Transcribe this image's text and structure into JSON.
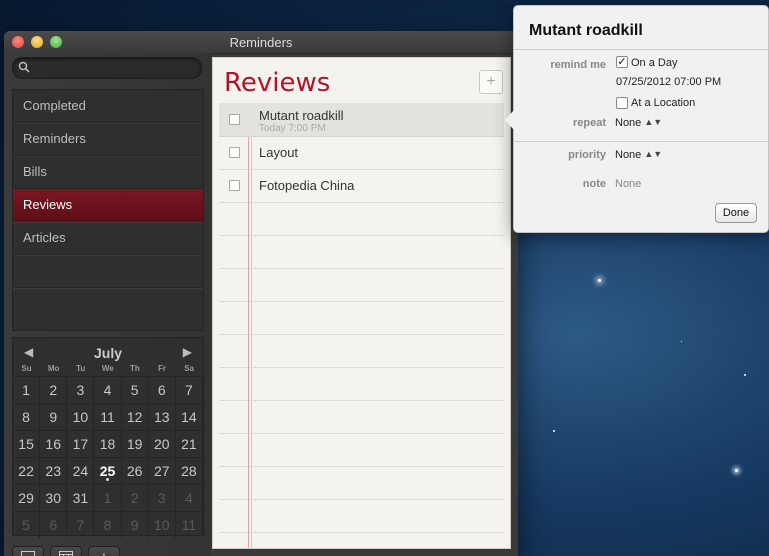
{
  "window": {
    "title": "Reminders"
  },
  "sidebar": {
    "search_placeholder": "",
    "lists": [
      {
        "label": "Completed"
      },
      {
        "label": "Reminders"
      },
      {
        "label": "Bills"
      },
      {
        "label": "Reviews",
        "selected": true
      },
      {
        "label": "Articles"
      }
    ]
  },
  "calendar": {
    "month": "July",
    "prev": "◀",
    "next": "▶",
    "weekdays": [
      "Su",
      "Mo",
      "Tu",
      "We",
      "Th",
      "Fr",
      "Sa"
    ],
    "weeks": [
      [
        "1",
        "2",
        "3",
        "4",
        "5",
        "6",
        "7"
      ],
      [
        "8",
        "9",
        "10",
        "11",
        "12",
        "13",
        "14"
      ],
      [
        "15",
        "16",
        "17",
        "18",
        "19",
        "20",
        "21"
      ],
      [
        "22",
        "23",
        "24",
        "25",
        "26",
        "27",
        "28"
      ],
      [
        "29",
        "30",
        "31",
        "1",
        "2",
        "3",
        "4"
      ],
      [
        "5",
        "6",
        "7",
        "8",
        "9",
        "10",
        "11"
      ]
    ],
    "today": "25"
  },
  "footer": {
    "add_label": "+"
  },
  "list_view": {
    "title": "Reviews",
    "add_label": "+",
    "items": [
      {
        "title": "Mutant roadkill",
        "subtitle": "Today 7:00 PM"
      },
      {
        "title": "Layout"
      },
      {
        "title": "Fotopedia China"
      }
    ]
  },
  "popover": {
    "title": "Mutant roadkill",
    "remind_me_label": "remind me",
    "on_a_day_label": "On a Day",
    "on_a_day_checked": "✓",
    "datetime": "07/25/2012  07:00 PM",
    "at_location_label": "At a Location",
    "repeat_label": "repeat",
    "repeat_value": "None",
    "priority_label": "priority",
    "priority_value": "None",
    "note_label": "note",
    "note_value": "None",
    "updown": "▲▼",
    "done_label": "Done"
  }
}
